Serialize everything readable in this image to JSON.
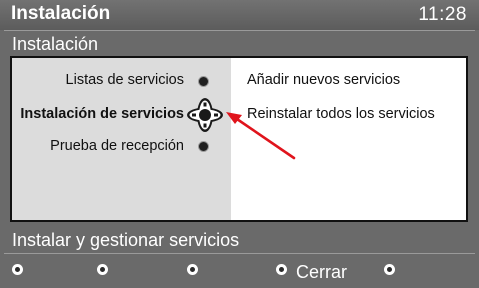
{
  "header": {
    "title": "Instalación",
    "clock": "11:28"
  },
  "subtitle": "Instalación",
  "menu": {
    "items": [
      {
        "label": "Listas de servicios",
        "active": false
      },
      {
        "label": "Instalación de servicios",
        "active": true
      },
      {
        "label": "Prueba de recepción",
        "active": false
      }
    ]
  },
  "submenu": {
    "items": [
      {
        "label": "Añadir nuevos servicios"
      },
      {
        "label": "Reinstalar todos los servicios"
      }
    ]
  },
  "hint": "Instalar y gestionar servicios",
  "footer": {
    "close_label": "Cerrar"
  },
  "icons": {
    "navigation": "dpad-cursor-icon",
    "pointer": "red-arrow-icon",
    "color_keys": "color-key-icon"
  },
  "colors": {
    "arrow": "#e0141c"
  }
}
